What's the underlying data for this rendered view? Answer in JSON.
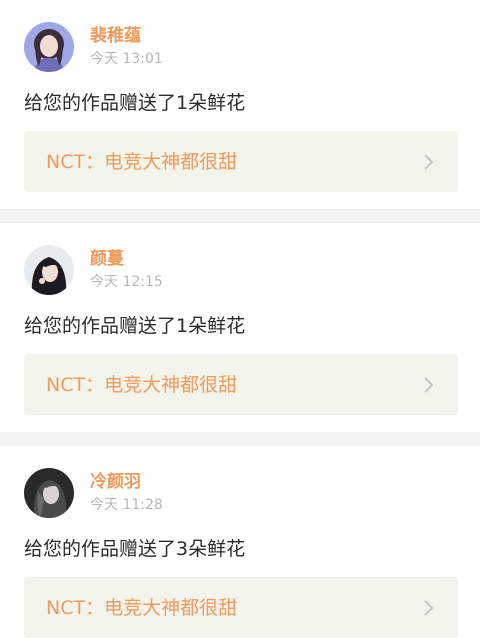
{
  "notifications": [
    {
      "username": "裴稚蕴",
      "timestamp": "今天 13:01",
      "message": "给您的作品赠送了1朵鲜花",
      "work_title": "NCT：电竞大神都很甜"
    },
    {
      "username": "颜蔓",
      "timestamp": "今天 12:15",
      "message": "给您的作品赠送了1朵鲜花",
      "work_title": "NCT：电竞大神都很甜"
    },
    {
      "username": "冷颜羽",
      "timestamp": "今天 11:28",
      "message": "给您的作品赠送了3朵鲜花",
      "work_title": "NCT：电竞大神都很甜"
    }
  ],
  "colors": {
    "accent": "#f09a5b",
    "link_card_bg": "#f3f5ec",
    "divider_bg": "#f4f4f4",
    "timestamp": "#b8b8b8"
  },
  "icons": {
    "link_arrow": "chevron-right-icon"
  }
}
